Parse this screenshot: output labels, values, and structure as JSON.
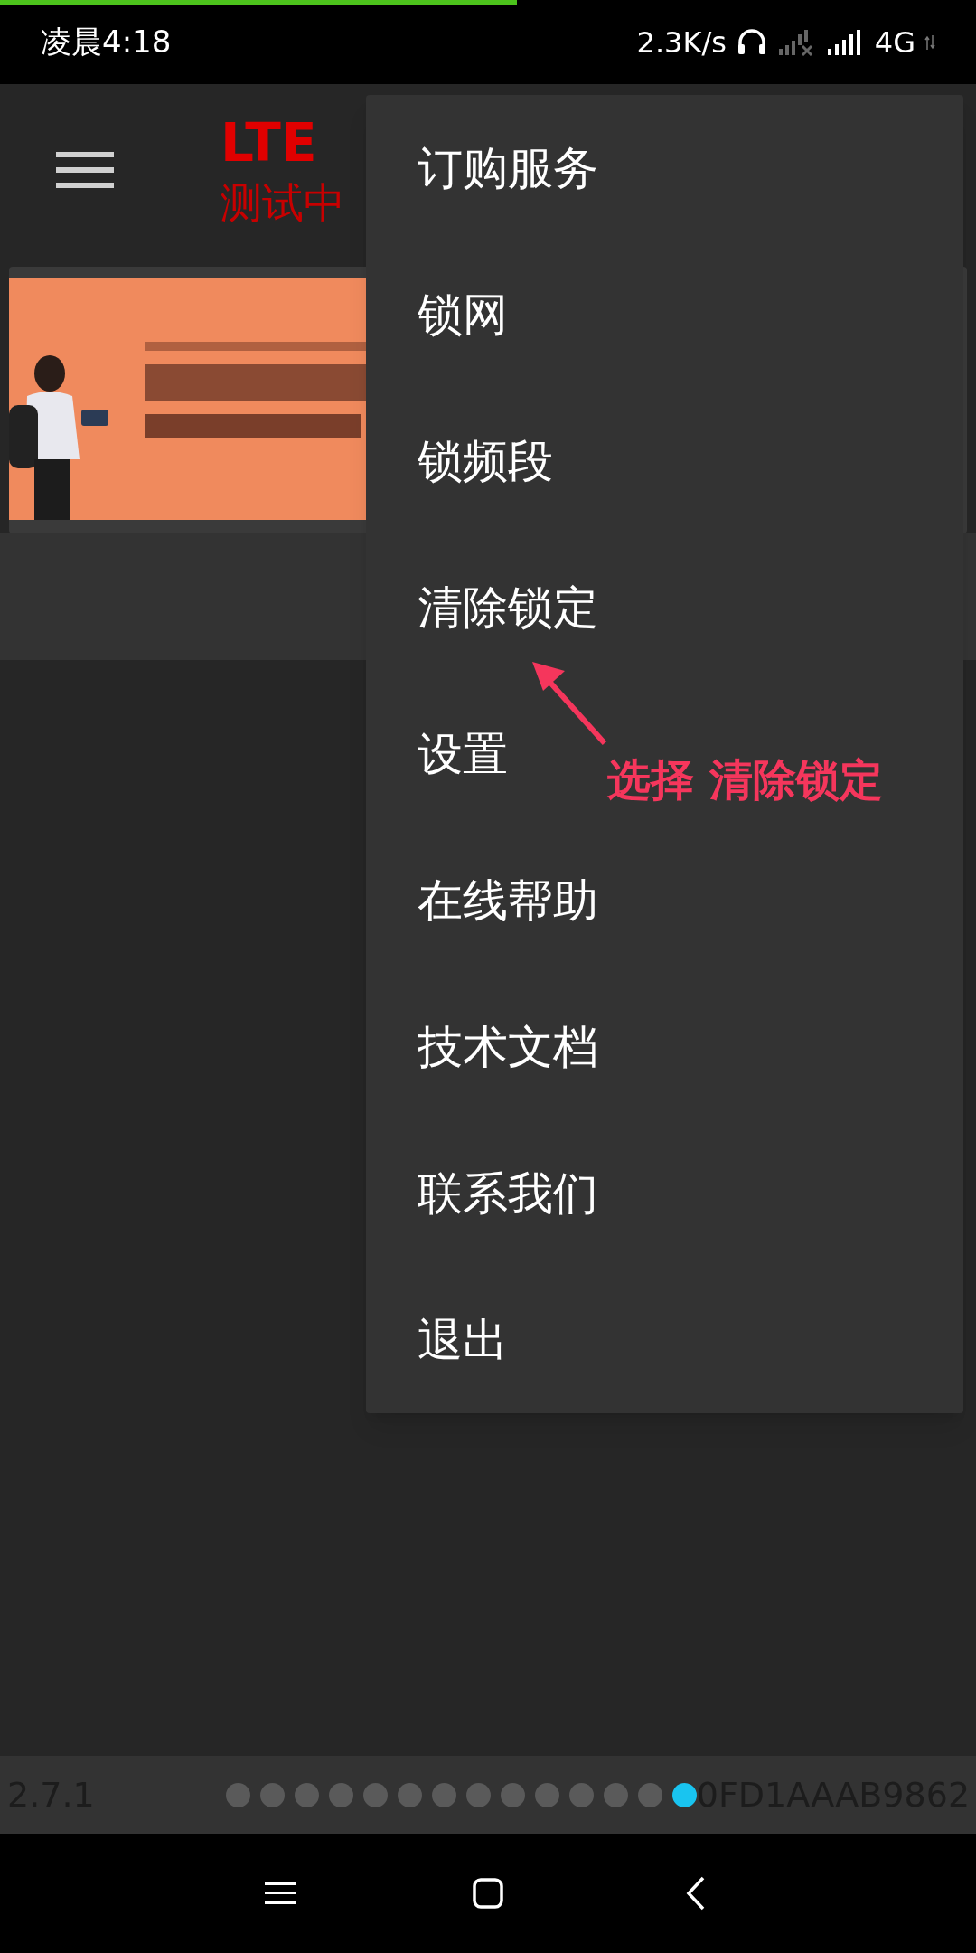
{
  "status_bar": {
    "progress": {
      "level": 0.53
    },
    "time": "凌晨4:18",
    "speed": "2.3K/s",
    "network": "4G"
  },
  "app_bar": {
    "title": "LTE",
    "subtitle": "测试中"
  },
  "menu": {
    "items": [
      {
        "label": "订购服务"
      },
      {
        "label": "锁网"
      },
      {
        "label": "锁频段"
      },
      {
        "label": "清除锁定"
      },
      {
        "label": "设置"
      },
      {
        "label": "在线帮助"
      },
      {
        "label": "技术文档"
      },
      {
        "label": "联系我们"
      },
      {
        "label": "退出"
      }
    ]
  },
  "annotation": {
    "text": "选择 清除锁定"
  },
  "footer": {
    "version": "2.7.1",
    "pages": [
      {
        "selected": false
      },
      {
        "selected": false
      },
      {
        "selected": false
      },
      {
        "selected": false
      },
      {
        "selected": false
      },
      {
        "selected": false
      },
      {
        "selected": false
      },
      {
        "selected": false
      },
      {
        "selected": false
      },
      {
        "selected": false
      },
      {
        "selected": false
      },
      {
        "selected": false
      },
      {
        "selected": false
      },
      {
        "selected": true
      }
    ],
    "device_id": "0FD1AAAB9862"
  }
}
